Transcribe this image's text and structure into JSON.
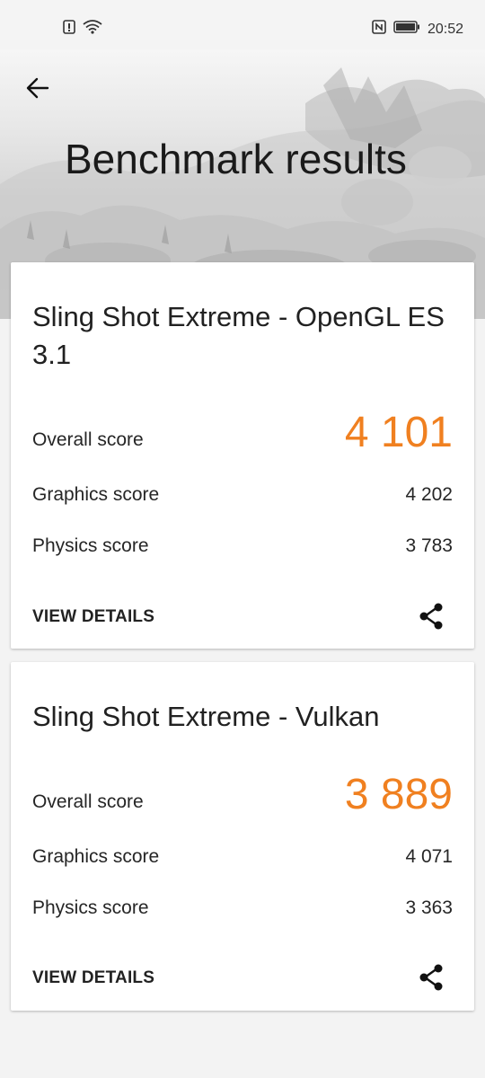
{
  "status_bar": {
    "time": "20:52",
    "icons": [
      "alert-icon",
      "wifi-icon",
      "nfc-icon",
      "battery-icon"
    ]
  },
  "header": {
    "back_icon": "arrow-left-icon",
    "title": "Benchmark results"
  },
  "results": [
    {
      "test_name": "Sling Shot Extreme - OpenGL ES 3.1",
      "overall_label": "Overall score",
      "overall_value": "4 101",
      "graphics_label": "Graphics score",
      "graphics_value": "4 202",
      "physics_label": "Physics score",
      "physics_value": "3 783",
      "view_details_label": "VIEW DETAILS",
      "share_icon": "share-icon"
    },
    {
      "test_name": "Sling Shot Extreme - Vulkan",
      "overall_label": "Overall score",
      "overall_value": "3 889",
      "graphics_label": "Graphics score",
      "graphics_value": "4 071",
      "physics_label": "Physics score",
      "physics_value": "3 363",
      "view_details_label": "VIEW DETAILS",
      "share_icon": "share-icon"
    }
  ],
  "colors": {
    "accent": "#f08020",
    "card_background": "#ffffff",
    "page_background": "#f3f3f3"
  }
}
